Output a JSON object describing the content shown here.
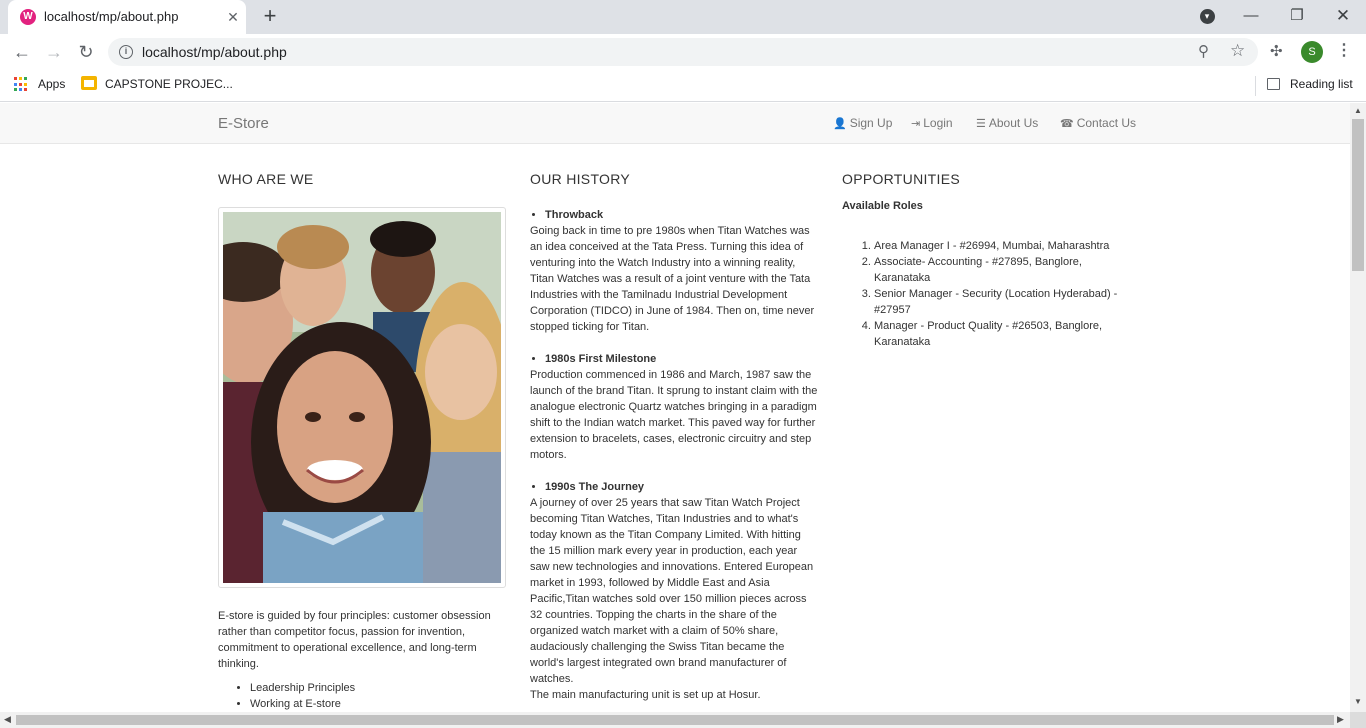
{
  "browser": {
    "tab_title": "localhost/mp/about.php",
    "url": "localhost/mp/about.php",
    "profile_initial": "S",
    "bookmarks": [
      {
        "label": "Apps",
        "icon": "apps-grid-icon"
      },
      {
        "label": "CAPSTONE PROJEC...",
        "icon": "folder-icon"
      }
    ],
    "reading_list_label": "Reading list"
  },
  "navbar": {
    "brand": "E-Store",
    "links": [
      {
        "label": "Sign Up",
        "icon": "user-icon"
      },
      {
        "label": "Login",
        "icon": "login-icon"
      },
      {
        "label": "About Us",
        "icon": "list-icon"
      },
      {
        "label": "Contact Us",
        "icon": "phone-icon"
      }
    ]
  },
  "who": {
    "heading": "WHO ARE WE",
    "photo_alt": "group of smiling young people",
    "text": "E-store is guided by four principles: customer obsession rather than competitor focus, passion for invention, commitment to operational excellence, and long-term thinking.",
    "list": [
      "Leadership Principles",
      "Working at E-store"
    ]
  },
  "history": {
    "heading": "OUR HISTORY",
    "items": [
      {
        "title": "Throwback",
        "body": "Going back in time to pre 1980s when Titan Watches was an idea conceived at the Tata Press. Turning this idea of venturing into the Watch Industry into a winning reality, Titan Watches was a result of a joint venture with the Tata Industries with the Tamilnadu Industrial Development Corporation (TIDCO) in June of 1984. Then on, time never stopped ticking for Titan."
      },
      {
        "title": "1980s First Milestone",
        "body": "Production commenced in 1986 and March, 1987 saw the launch of the brand Titan. It sprung to instant claim with the analogue electronic Quartz watches bringing in a paradigm shift to the Indian watch market. This paved way for further extension to bracelets, cases, electronic circuitry and step motors."
      },
      {
        "title": "1990s The Journey",
        "body": "A journey of over 25 years that saw Titan Watch Project becoming Titan Watches, Titan Industries and to what's today known as the Titan Company Limited. With hitting the 15 million mark every year in production, each year saw new technologies and innovations. Entered European market in 1993, followed by Middle East and Asia Pacific,Titan watches sold over 150 million pieces across 32 countries. Topping the charts in the share of the organized watch market with a claim of 50% share, audaciously challenging the Swiss Titan became the world's largest integrated own brand manufacturer of watches.",
        "extra": "The main manufacturing unit is set up at Hosur."
      }
    ]
  },
  "opportunities": {
    "heading": "OPPORTUNITIES",
    "roles_heading": "Available Roles",
    "roles": [
      "Area Manager I - #26994, Mumbai, Maharashtra",
      "Associate- Accounting - #27895, Banglore, Karanataka",
      "Senior Manager - Security (Location Hyderabad) - #27957",
      "Manager - Product Quality - #26503, Banglore, Karanataka"
    ]
  }
}
